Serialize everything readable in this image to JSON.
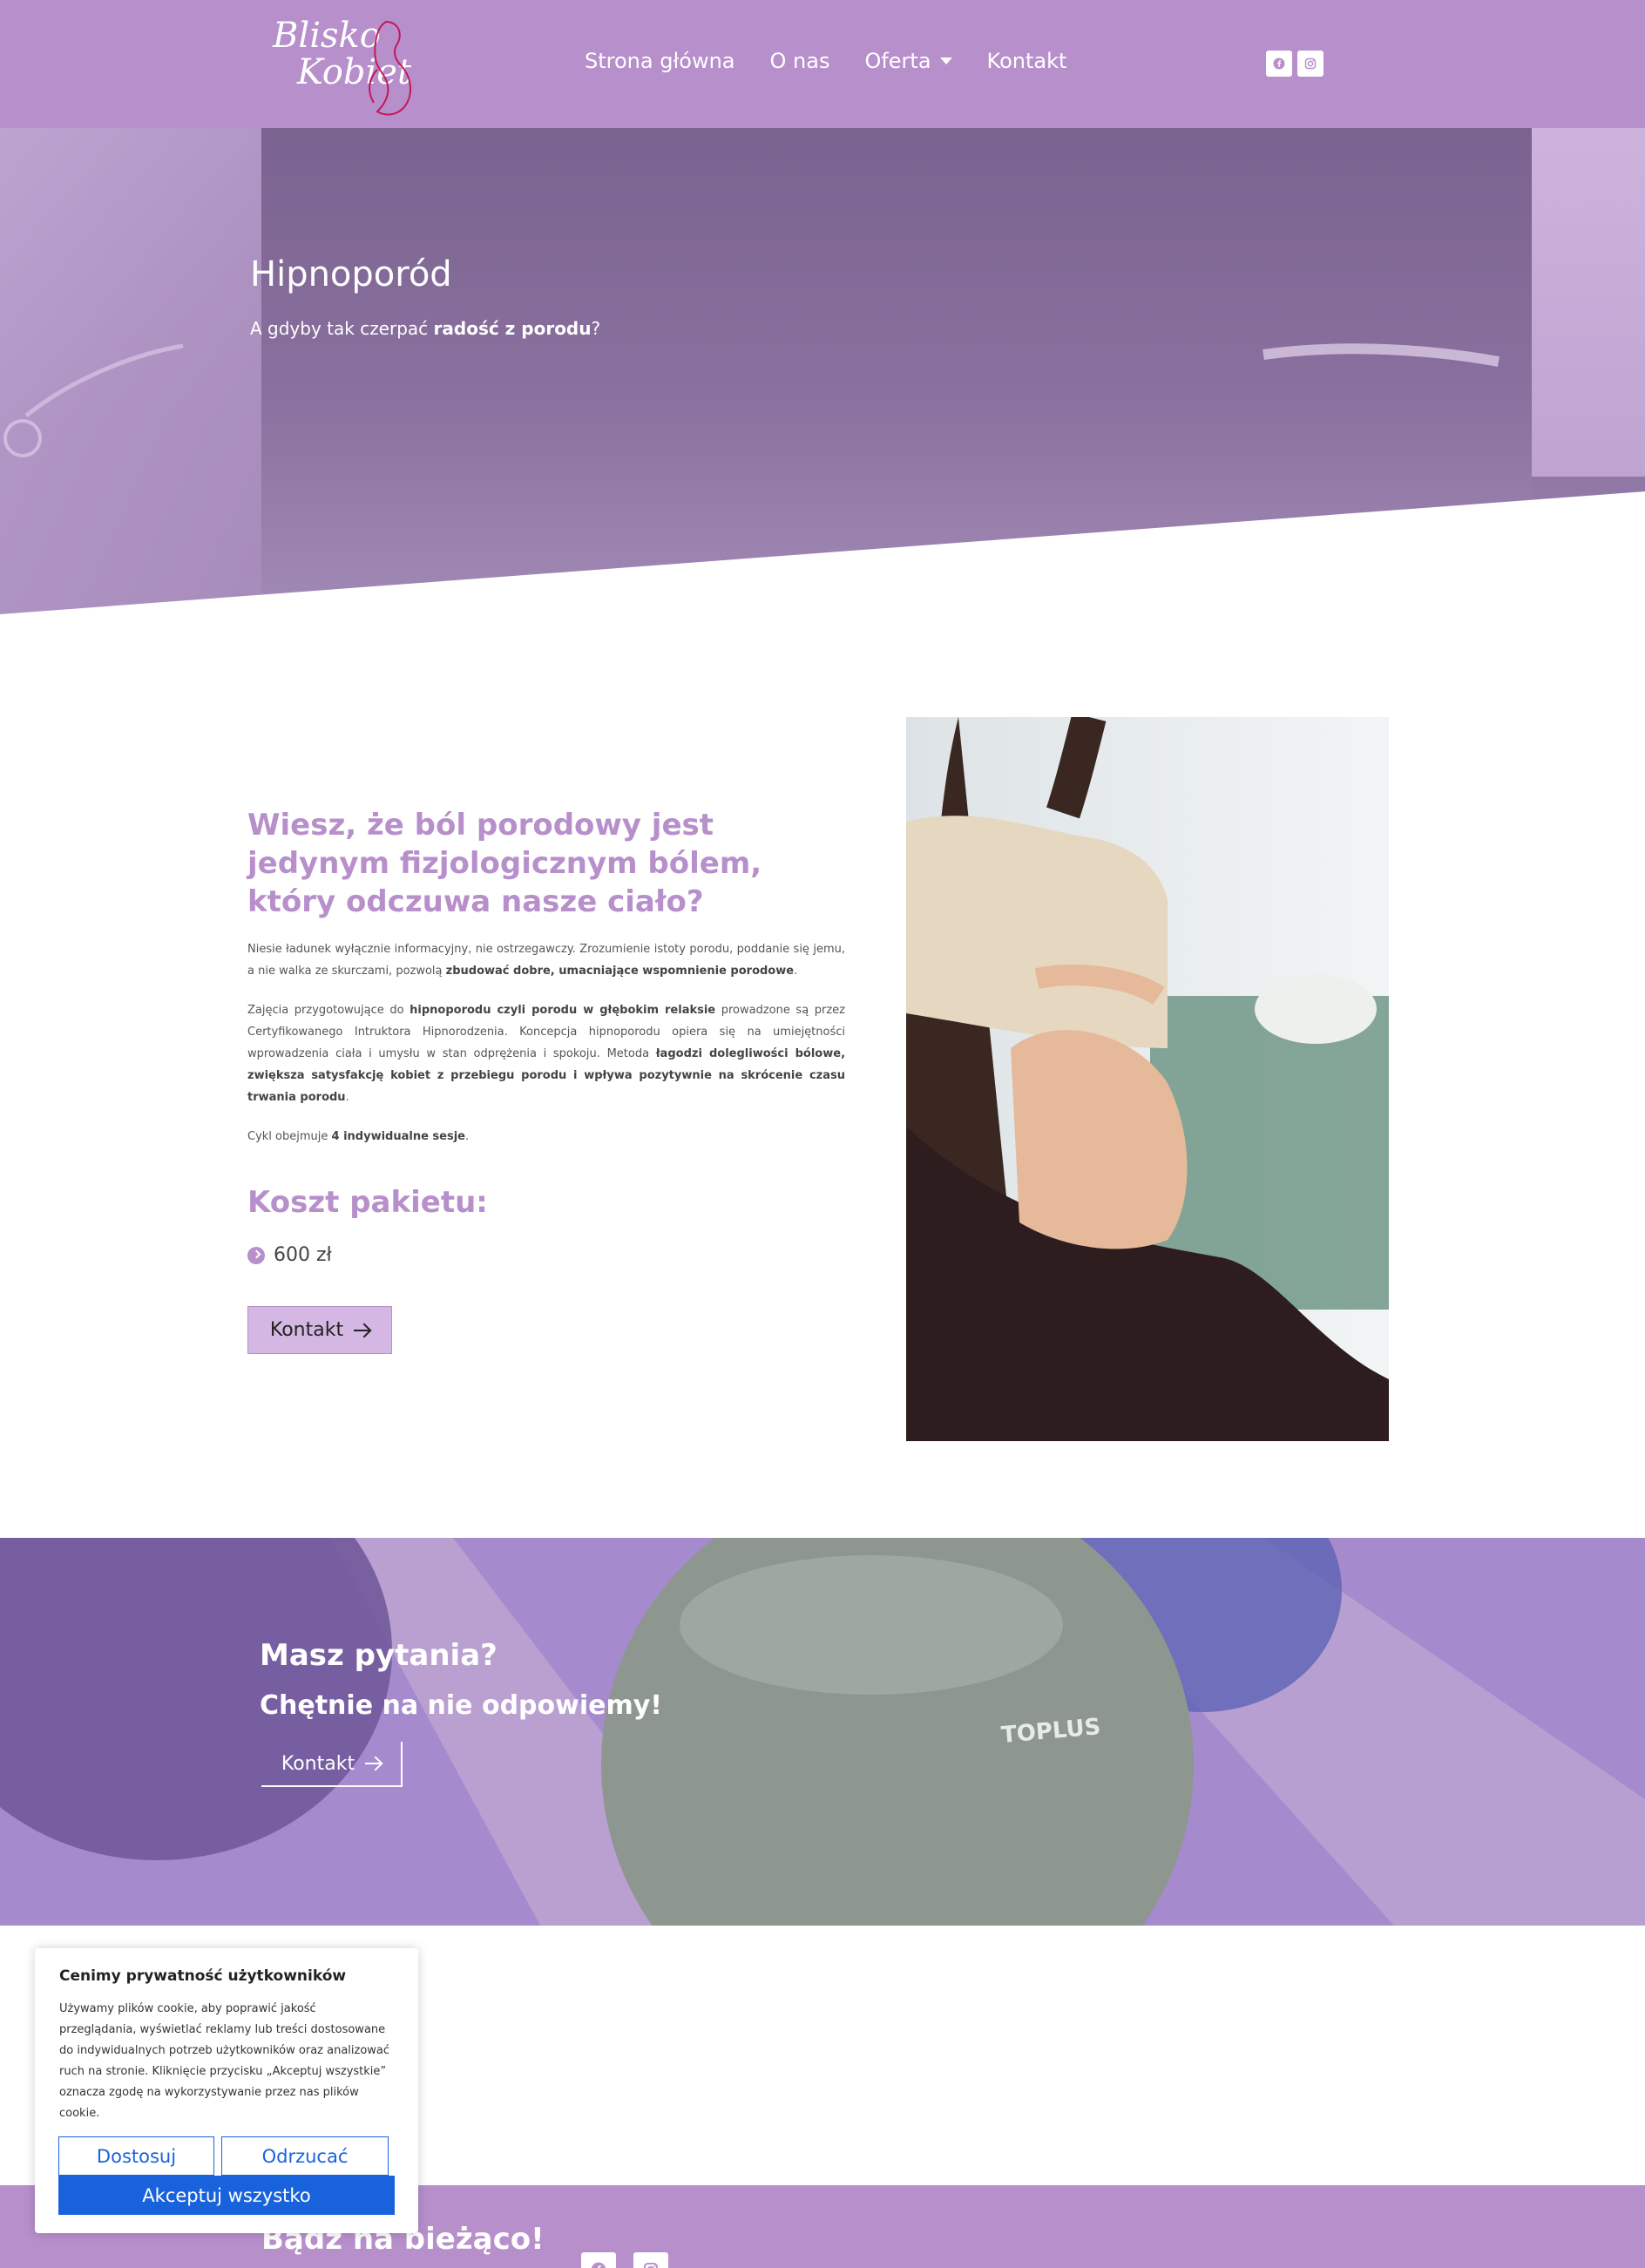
{
  "header": {
    "logo_text_line1": "Blisko",
    "logo_text_line2": "Kobiet",
    "nav": [
      {
        "label": "Strona główna"
      },
      {
        "label": "O nas"
      },
      {
        "label": "Oferta"
      },
      {
        "label": "Kontakt"
      }
    ],
    "social_icons": [
      "facebook-icon",
      "instagram-icon"
    ]
  },
  "hero": {
    "title": "Hipnoporód",
    "subtitle_prefix": "A gdyby tak czerpać ",
    "subtitle_bold": "radość z porodu",
    "subtitle_suffix": "?"
  },
  "content": {
    "heading": "Wiesz, że ból porodowy jest jedynym fizjologicznym bólem, który odczuwa nasze ciało?",
    "p1_a": "Niesie ładunek wyłącznie informacyjny, nie ostrzegawczy. Zrozumienie istoty porodu, poddanie się jemu, a nie walka ze skurczami, pozwolą ",
    "p1_b": "zbudować dobre, umacniające wspomnienie porodowe",
    "p1_c": ".",
    "p2_a": "Zajęcia przygotowujące do ",
    "p2_b": "hipnoporodu czyli porodu w głębokim relaksie",
    "p2_c": " prowadzone są przez Certyfikowanego Intruktora Hipnorodzenia. Koncepcja hipnoporodu opiera się na umiejętności wprowadzenia ciała i umysłu w stan odprężenia i spokoju. Metoda ",
    "p2_d": "łagodzi dolegliwości bólowe, zwiększa satysfakcję kobiet z przebiegu porodu i wpływa pozytywnie na skrócenie czasu trwania porodu",
    "p2_e": ".",
    "p3_a": "Cykl obejmuje ",
    "p3_b": "4 indywidualne sesje",
    "p3_c": ".",
    "price_heading": "Koszt pakietu:",
    "price": "600 zł",
    "button": "Kontakt"
  },
  "questions": {
    "title": "Masz pytania?",
    "subtitle": "Chętnie na nie odpowiemy!",
    "button": "Kontakt",
    "ball_text": "TOPLUS"
  },
  "footer": {
    "title": "Bądź na bieżąco!"
  },
  "cookie": {
    "title": "Cenimy prywatność użytkowników",
    "text": "Używamy plików cookie, aby poprawić jakość przeglądania, wyświetlać reklamy lub treści dostosowane do indywidualnych potrzeb użytkowników oraz analizować ruch na stronie. Kliknięcie przycisku „Akceptuj wszystkie” oznacza zgodę na wykorzystywanie przez nas plików cookie.",
    "customize": "Dostosuj",
    "reject": "Odrzucać",
    "accept": "Akceptuj wszystko"
  },
  "colors": {
    "brand": "#b78fcb",
    "cookie_accent": "#1863dc"
  }
}
